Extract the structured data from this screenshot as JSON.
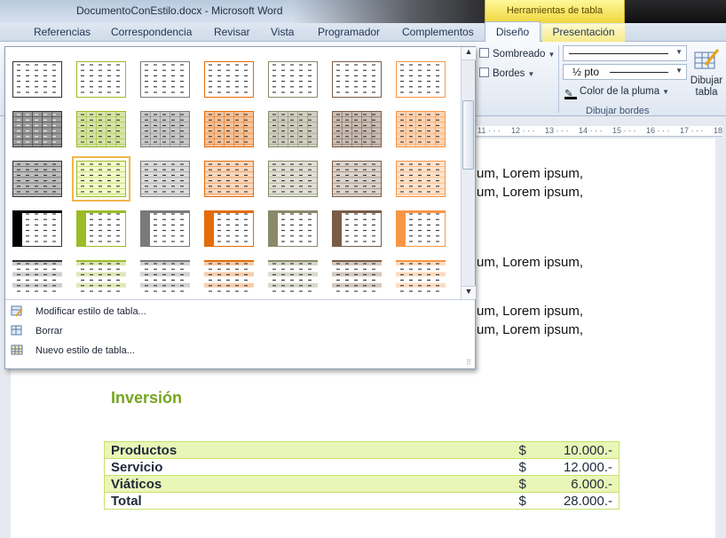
{
  "window": {
    "title": "DocumentoConEstilo.docx  -  Microsoft Word",
    "context_group": "Herramientas de tabla"
  },
  "tabs": [
    "Referencias",
    "Correspondencia",
    "Revisar",
    "Vista",
    "Programador",
    "Complementos"
  ],
  "context_tabs": {
    "design": "Diseño",
    "layout": "Presentación"
  },
  "ribbon": {
    "shading": "Sombreado",
    "borders": "Bordes",
    "line_weight": "½ pto",
    "pen_color": "Color de la pluma",
    "draw_table": "Dibujar tabla",
    "group_label": "Dibujar bordes"
  },
  "ruler": [
    "11",
    "12",
    "13",
    "14",
    "15",
    "16",
    "17",
    "18"
  ],
  "gallery": {
    "menu": [
      "Modificar estilo de tabla...",
      "Borrar",
      "Nuevo estilo de tabla..."
    ],
    "colors": [
      "#333333",
      "#9bbb27",
      "#7a7a7a",
      "#e46c0a",
      "#8a8a6a",
      "#7a5c46",
      "#f79646"
    ],
    "selected": {
      "row": 2,
      "col": 1
    }
  },
  "document": {
    "lorem": [
      "um, Lorem ipsum,",
      "um, Lorem ipsum,",
      "um, Lorem ipsum,",
      "um, Lorem ipsum,",
      "um, Lorem ipsum,"
    ],
    "heading": "Inversión",
    "table": [
      {
        "label": "Productos",
        "currency": "$",
        "amount": "10.000.-"
      },
      {
        "label": "Servicio",
        "currency": "$",
        "amount": "12.000.-"
      },
      {
        "label": "Viáticos",
        "currency": "$",
        "amount": "6.000.-"
      },
      {
        "label": "Total",
        "currency": "$",
        "amount": "28.000.-"
      }
    ]
  }
}
